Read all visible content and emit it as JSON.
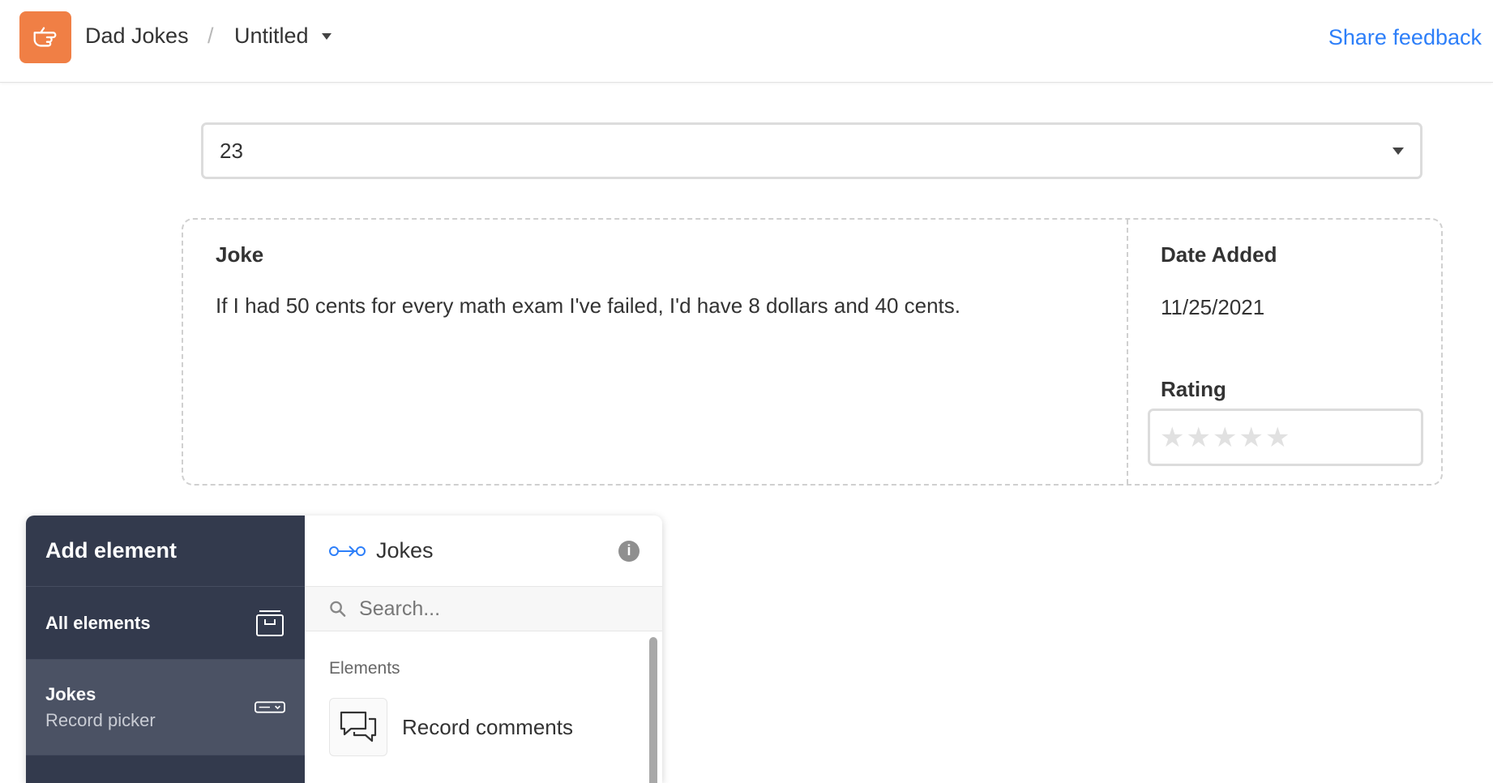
{
  "header": {
    "app_name": "Dad Jokes",
    "separator": "/",
    "page_name": "Untitled",
    "share_feedback": "Share feedback",
    "logo_color": "#f07f45",
    "link_color": "#2d7ff9"
  },
  "record_select": {
    "value": "23"
  },
  "record": {
    "joke_label": "Joke",
    "joke_text": "If I had 50 cents for every math exam I've failed, I'd have 8 dollars and 40 cents.",
    "date_label": "Date Added",
    "date_value": "11/25/2021",
    "rating_label": "Rating",
    "rating_value": 0,
    "rating_max": 5,
    "star_glyph": "★"
  },
  "panel": {
    "title": "Add element",
    "nav": [
      {
        "label": "All elements",
        "icon": "archive-box-icon"
      },
      {
        "label": "Jokes",
        "sublabel": "Record picker",
        "icon": "dropdown-field-icon"
      }
    ],
    "table_name": "Jokes",
    "info_glyph": "i",
    "search_placeholder": "Search...",
    "section_label": "Elements",
    "elements": [
      {
        "label": "Record comments",
        "icon": "comments-icon"
      }
    ],
    "sidebar_color": "#333a4d",
    "selected_color": "#4b5264"
  }
}
